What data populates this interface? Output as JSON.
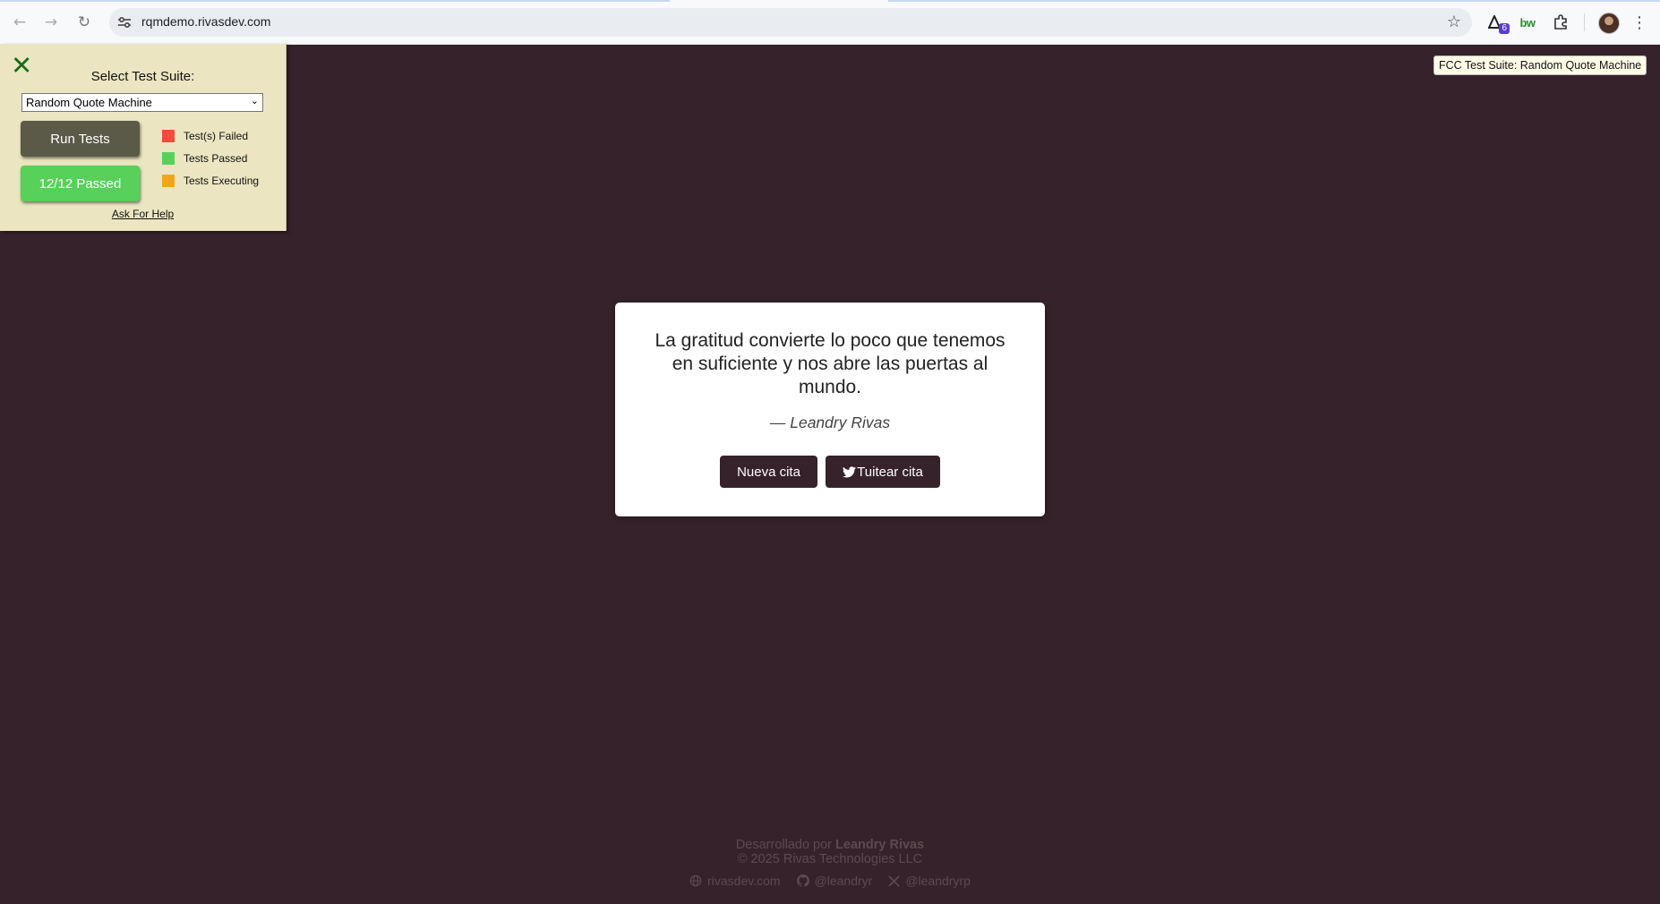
{
  "browser": {
    "url": "rqmdemo.rivasdev.com",
    "extension_badge": "6",
    "bw_label": "bw"
  },
  "fcc_panel": {
    "title": "Select Test Suite:",
    "selected_suite": "Random Quote Machine",
    "run_button": "Run Tests",
    "result_button": "12/12 Passed",
    "legend": [
      {
        "label": "Test(s) Failed",
        "color": "#f44b3c"
      },
      {
        "label": "Tests Passed",
        "color": "#57d15a"
      },
      {
        "label": "Tests Executing",
        "color": "#f5a41e"
      }
    ],
    "help_link": "Ask For Help",
    "tooltip": "FCC Test Suite: Random Quote Machine"
  },
  "quote": {
    "text": "La gratitud convierte lo poco que tenemos en suficiente y nos abre las puertas al mundo.",
    "author": "— Leandry Rivas",
    "new_button": "Nueva cita",
    "tweet_button": "Tuitear cita"
  },
  "footer": {
    "developed_by_prefix": "Desarrollado por ",
    "developer_name": "Leandry Rivas",
    "copyright": "© 2025 Rivas Technologies LLC",
    "links": {
      "website": "rivasdev.com",
      "github": "@leandryr",
      "x": "@leandryrp"
    }
  },
  "colors": {
    "page_background": "#36222a",
    "panel_background": "#ebe6c1",
    "passed_green": "#57d15a"
  }
}
